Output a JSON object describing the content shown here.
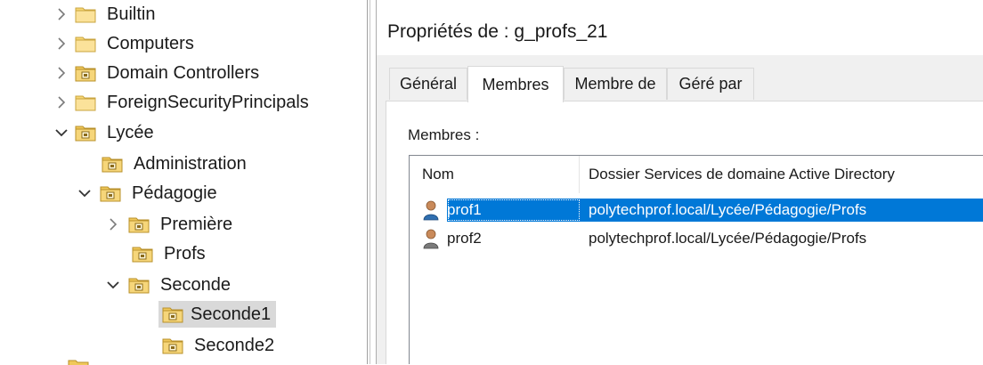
{
  "tree": {
    "items": [
      {
        "label": "Builtin",
        "chevron": "right",
        "folder": "plain"
      },
      {
        "label": "Computers",
        "chevron": "right",
        "folder": "plain"
      },
      {
        "label": "Domain Controllers",
        "chevron": "right",
        "folder": "ou"
      },
      {
        "label": "ForeignSecurityPrincipals",
        "chevron": "right",
        "folder": "plain"
      },
      {
        "label": "Lycée",
        "chevron": "down",
        "folder": "ou"
      },
      {
        "label": "Administration",
        "chevron": "none",
        "folder": "ou"
      },
      {
        "label": "Pédagogie",
        "chevron": "down",
        "folder": "ou"
      },
      {
        "label": "Première",
        "chevron": "right",
        "folder": "ou"
      },
      {
        "label": "Profs",
        "chevron": "none",
        "folder": "ou"
      },
      {
        "label": "Seconde",
        "chevron": "down",
        "folder": "ou"
      },
      {
        "label": "Seconde1",
        "chevron": "none",
        "folder": "ou",
        "selected": true
      },
      {
        "label": "Seconde2",
        "chevron": "none",
        "folder": "ou"
      }
    ]
  },
  "dialog": {
    "title": "Propriétés de : g_profs_21",
    "tabs": [
      {
        "label": "Général",
        "active": false
      },
      {
        "label": "Membres",
        "active": true
      },
      {
        "label": "Membre de",
        "active": false
      },
      {
        "label": "Géré par",
        "active": false
      }
    ],
    "members_label": "Membres :",
    "columns": [
      "Nom",
      "Dossier Services de domaine Active Directory"
    ],
    "rows": [
      {
        "name": "prof1",
        "folder": "polytechprof.local/Lycée/Pédagogie/Profs",
        "selected": true,
        "icon": "user-icon"
      },
      {
        "name": "prof2",
        "folder": "polytechprof.local/Lycée/Pédagogie/Profs",
        "selected": false,
        "icon": "user-icon"
      }
    ]
  },
  "colors": {
    "selection": "#0078d7",
    "tree_selection": "#d9d9d9",
    "folder_yellow": "#f5d77c"
  }
}
